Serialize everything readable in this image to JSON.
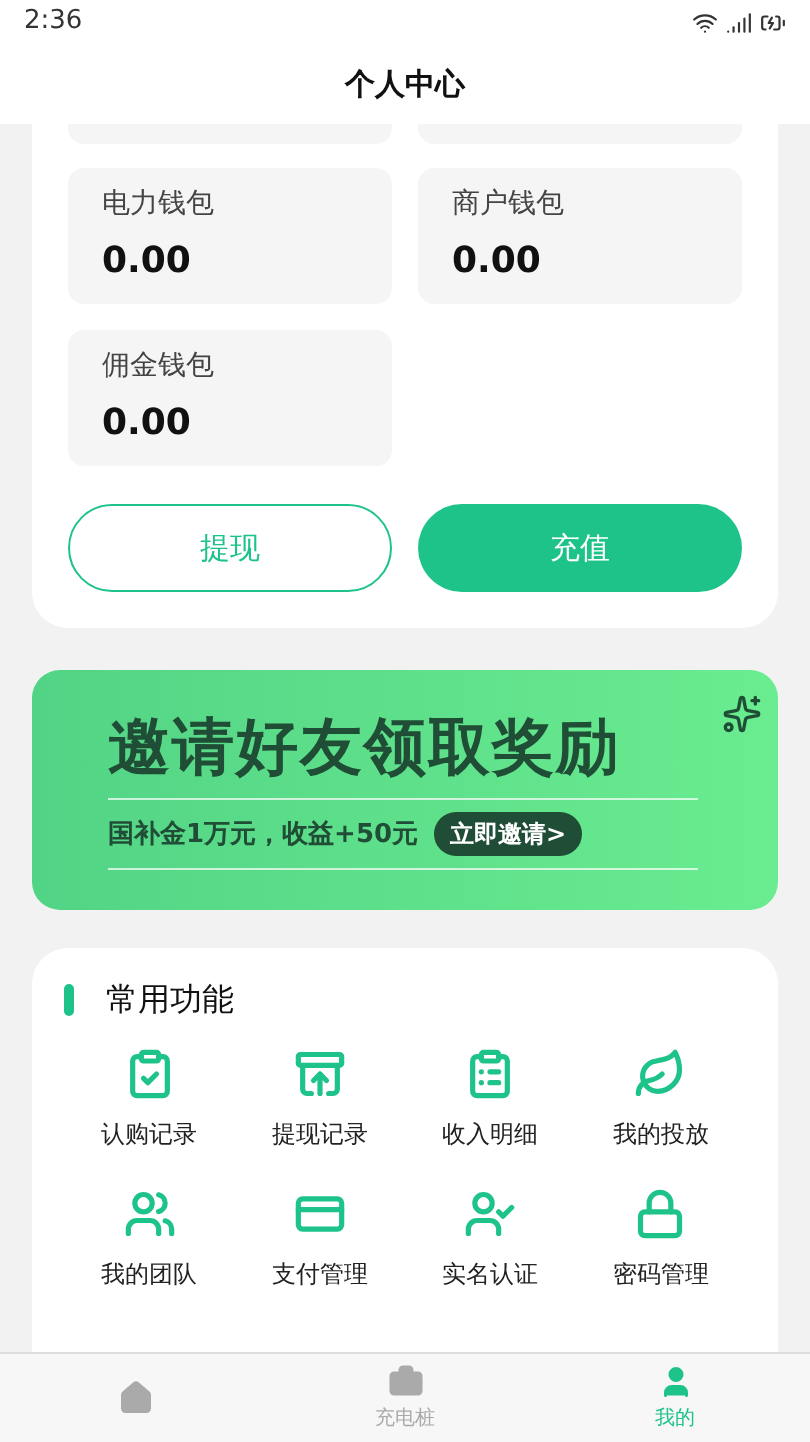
{
  "status_bar": {
    "time": "2:36"
  },
  "header": {
    "title": "个人中心"
  },
  "wallets": [
    {
      "label": "电力钱包",
      "amount": "0.00"
    },
    {
      "label": "商户钱包",
      "amount": "0.00"
    },
    {
      "label": "佣金钱包",
      "amount": "0.00"
    }
  ],
  "actions": [
    {
      "label": "提现",
      "kind": "outline"
    },
    {
      "label": "充值",
      "kind": "filled"
    }
  ],
  "banner": {
    "title": "邀请好友领取奖励",
    "subtitle": "国补金1万元，收益+50元",
    "button": "立即邀请>"
  },
  "functions": {
    "title": "常用功能",
    "items": [
      {
        "label": "认购记录"
      },
      {
        "label": "提现记录"
      },
      {
        "label": "收入明细"
      },
      {
        "label": "我的投放"
      },
      {
        "label": "我的团队"
      },
      {
        "label": "支付管理"
      },
      {
        "label": "实名认证"
      },
      {
        "label": "密码管理"
      }
    ]
  },
  "tabs": [
    {
      "selected": false
    },
    {
      "label": "充电桩",
      "selected": false
    },
    {
      "label": "我的",
      "selected": true
    }
  ]
}
